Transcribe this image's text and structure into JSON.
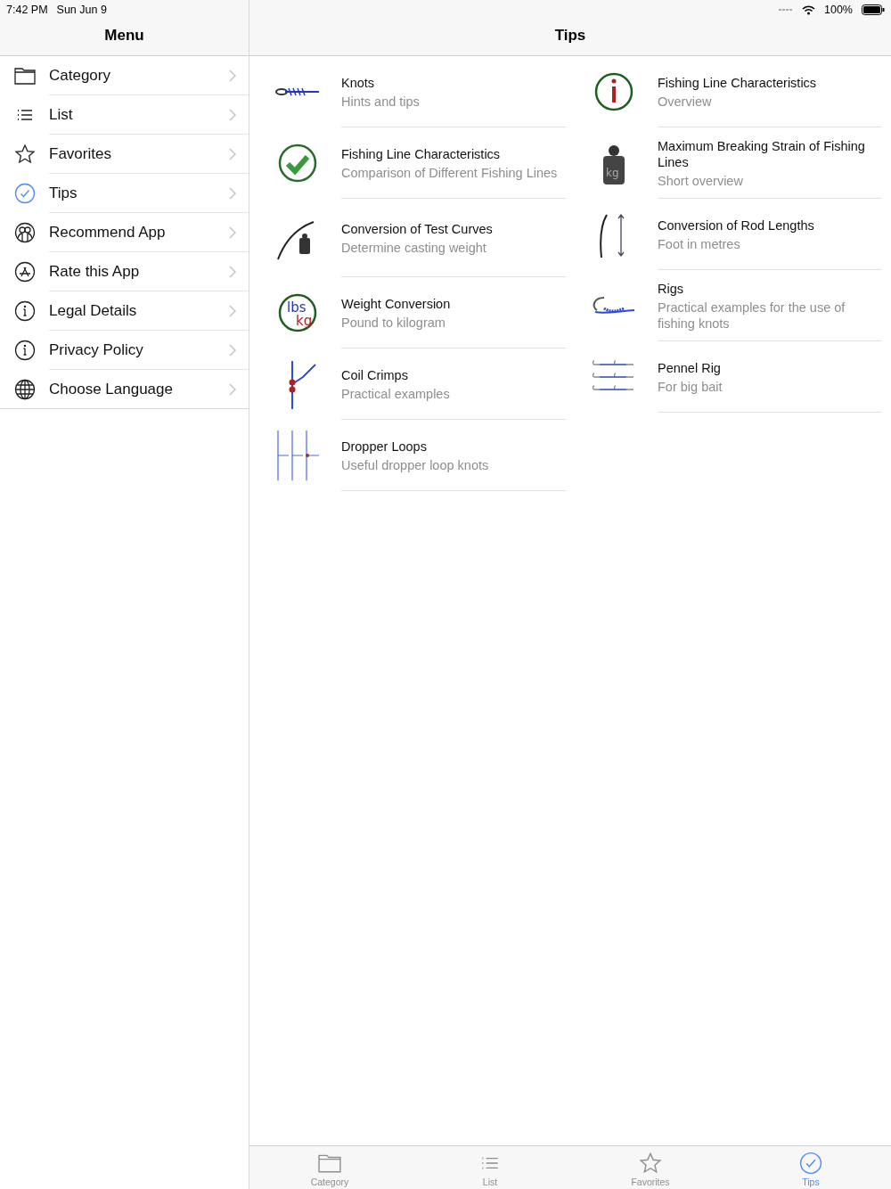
{
  "status_bar": {
    "time": "7:42 PM",
    "date": "Sun Jun 9",
    "battery": "100%"
  },
  "sidebar": {
    "title": "Menu",
    "items": [
      {
        "label": "Category",
        "kind": "folder"
      },
      {
        "label": "List",
        "kind": "list"
      },
      {
        "label": "Favorites",
        "kind": "star"
      },
      {
        "label": "Tips",
        "kind": "check"
      },
      {
        "label": "Recommend App",
        "kind": "people"
      },
      {
        "label": "Rate this App",
        "kind": "appstore"
      },
      {
        "label": "Legal Details",
        "kind": "info"
      },
      {
        "label": "Privacy Policy",
        "kind": "info"
      },
      {
        "label": "Choose Language",
        "kind": "globe"
      }
    ]
  },
  "main": {
    "title": "Tips",
    "columns": [
      [
        {
          "title": "Knots",
          "subtitle": "Hints and tips",
          "kind": "knot"
        },
        {
          "title": "Fishing Line Characteristics",
          "subtitle": "Comparison of Different Fishing Lines",
          "kind": "greencheck"
        },
        {
          "title": "Conversion of Test Curves",
          "subtitle": "Determine casting weight",
          "kind": "rodweight"
        },
        {
          "title": "Weight Conversion",
          "subtitle": "Pound to kilogram",
          "kind": "units",
          "icon_text": [
            "lbs",
            "kg"
          ]
        },
        {
          "title": "Coil Crimps",
          "subtitle": "Practical examples",
          "kind": "crimp"
        },
        {
          "title": "Dropper Loops",
          "subtitle": "Useful dropper loop knots",
          "kind": "dropper"
        }
      ],
      [
        {
          "title": "Fishing Line Characteristics",
          "subtitle": "Overview",
          "kind": "info"
        },
        {
          "title": "Maximum Breaking Strain of Fishing Lines",
          "subtitle": "Short overview",
          "kind": "weight",
          "icon_text": [
            "kg"
          ]
        },
        {
          "title": "Conversion of Rod Lengths",
          "subtitle": "Foot in metres",
          "kind": "rodlength"
        },
        {
          "title": "Rigs",
          "subtitle": "Practical examples for the use of fishing knots",
          "kind": "hook"
        },
        {
          "title": "Pennel Rig",
          "subtitle": "For big bait",
          "kind": "pennel"
        }
      ]
    ]
  },
  "tab_bar": [
    {
      "label": "Category",
      "kind": "folder",
      "selected": false
    },
    {
      "label": "List",
      "kind": "list",
      "selected": false
    },
    {
      "label": "Favorites",
      "kind": "star",
      "selected": false
    },
    {
      "label": "Tips",
      "kind": "check",
      "selected": true
    }
  ]
}
